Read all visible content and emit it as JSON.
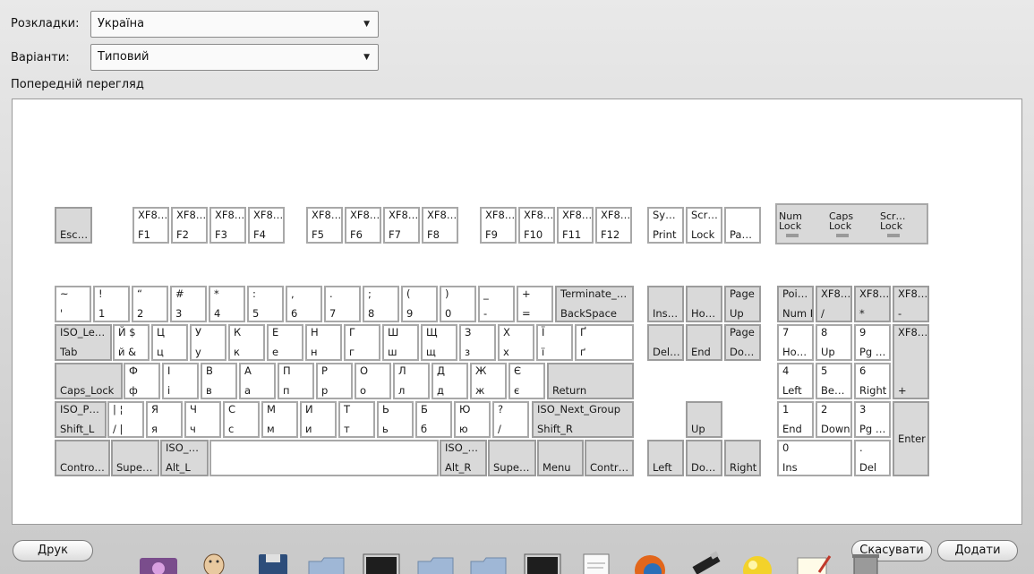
{
  "form": {
    "layouts_label": "Розкладки:",
    "layouts_value": "Україна",
    "variants_label": "Варіанти:",
    "variants_value": "Типовий",
    "preview_label": "Попередній перегляд"
  },
  "buttons": {
    "print": "Друк",
    "cancel": "Скасувати",
    "add": "Додати"
  },
  "colors": {
    "key_fill": "#ffffff",
    "mod_key_fill": "#d9d9d9",
    "key_border": "#a8a8a8"
  },
  "indicators": [
    {
      "top": "Num",
      "bottom": "Lock"
    },
    {
      "top": "Caps",
      "bottom": "Lock"
    },
    {
      "top": "Scr…",
      "bottom": "Lock"
    }
  ],
  "keys": [
    {
      "top": "",
      "bottom": "Esc…",
      "mod": true
    },
    {
      "top": "XF8…",
      "bottom": "F1"
    },
    {
      "top": "XF8…",
      "bottom": "F2"
    },
    {
      "top": "XF8…",
      "bottom": "F3"
    },
    {
      "top": "XF8…",
      "bottom": "F4"
    },
    {
      "top": "XF8…",
      "bottom": "F5"
    },
    {
      "top": "XF8…",
      "bottom": "F6"
    },
    {
      "top": "XF8…",
      "bottom": "F7"
    },
    {
      "top": "XF8…",
      "bottom": "F8"
    },
    {
      "top": "XF8…",
      "bottom": "F9"
    },
    {
      "top": "XF8…",
      "bottom": "F10"
    },
    {
      "top": "XF8…",
      "bottom": "F11"
    },
    {
      "top": "XF8…",
      "bottom": "F12"
    },
    {
      "top": "Sy…",
      "bottom": "Print"
    },
    {
      "top": "Scr…",
      "bottom": "Lock"
    },
    {
      "top": "",
      "bottom": "Pa…"
    },
    {
      "top": "~",
      "bottom": "'"
    },
    {
      "top": "!",
      "bottom": "1"
    },
    {
      "top": "“",
      "bottom": "2"
    },
    {
      "top": "#",
      "bottom": "3"
    },
    {
      "top": "*",
      "bottom": "4"
    },
    {
      "top": ":",
      "bottom": "5"
    },
    {
      "top": ",",
      "bottom": "6"
    },
    {
      "top": ".",
      "bottom": "7"
    },
    {
      "top": ";",
      "bottom": "8"
    },
    {
      "top": "(",
      "bottom": "9"
    },
    {
      "top": ")",
      "bottom": "0"
    },
    {
      "top": "_",
      "bottom": "-"
    },
    {
      "top": "+",
      "bottom": "="
    },
    {
      "top": "Terminate_…",
      "bottom": "BackSpace",
      "mod": true
    },
    {
      "top": "ISO_Le…",
      "bottom": "Tab",
      "mod": true
    },
    {
      "top": "Й $",
      "bottom": "й &"
    },
    {
      "top": "Ц",
      "bottom": "ц"
    },
    {
      "top": "У",
      "bottom": "у"
    },
    {
      "top": "К",
      "bottom": "к"
    },
    {
      "top": "Е",
      "bottom": "е"
    },
    {
      "top": "Н",
      "bottom": "н"
    },
    {
      "top": "Г",
      "bottom": "г"
    },
    {
      "top": "Ш",
      "bottom": "ш"
    },
    {
      "top": "Щ",
      "bottom": "щ"
    },
    {
      "top": "З",
      "bottom": "з"
    },
    {
      "top": "Х",
      "bottom": "х"
    },
    {
      "top": "Ї",
      "bottom": "ї"
    },
    {
      "top": "Ґ",
      "bottom": "ґ"
    },
    {
      "top": "",
      "bottom": "Caps_Lock",
      "mod": true
    },
    {
      "top": "Ф",
      "bottom": "ф"
    },
    {
      "top": "І",
      "bottom": "і"
    },
    {
      "top": "В",
      "bottom": "в"
    },
    {
      "top": "А",
      "bottom": "а"
    },
    {
      "top": "П",
      "bottom": "п"
    },
    {
      "top": "Р",
      "bottom": "р"
    },
    {
      "top": "О",
      "bottom": "о"
    },
    {
      "top": "Л",
      "bottom": "л"
    },
    {
      "top": "Д",
      "bottom": "д"
    },
    {
      "top": "Ж",
      "bottom": "ж"
    },
    {
      "top": "Є",
      "bottom": "є"
    },
    {
      "top": "",
      "bottom": "Return",
      "mod": true
    },
    {
      "top": "ISO_P…",
      "bottom": "Shift_L",
      "mod": true
    },
    {
      "top": "|  ¦",
      "bottom": "/  |"
    },
    {
      "top": "Я",
      "bottom": "я"
    },
    {
      "top": "Ч",
      "bottom": "ч"
    },
    {
      "top": "С",
      "bottom": "с"
    },
    {
      "top": "М",
      "bottom": "м"
    },
    {
      "top": "И",
      "bottom": "и"
    },
    {
      "top": "Т",
      "bottom": "т"
    },
    {
      "top": "Ь",
      "bottom": "ь"
    },
    {
      "top": "Б",
      "bottom": "б"
    },
    {
      "top": "Ю",
      "bottom": "ю"
    },
    {
      "top": "?",
      "bottom": "/"
    },
    {
      "top": "ISO_Next_Group",
      "bottom": "Shift_R",
      "mod": true
    },
    {
      "top": "",
      "bottom": "Contro…",
      "mod": true
    },
    {
      "top": "",
      "bottom": "Supe…",
      "mod": true
    },
    {
      "top": "ISO_…",
      "bottom": "Alt_L",
      "mod": true
    },
    {
      "top": "",
      "bottom": ""
    },
    {
      "top": "ISO_…",
      "bottom": "Alt_R",
      "mod": true
    },
    {
      "top": "",
      "bottom": "Supe…",
      "mod": true
    },
    {
      "top": "",
      "bottom": "Menu",
      "mod": true
    },
    {
      "top": "",
      "bottom": "Contr…",
      "mod": true
    },
    {
      "top": "",
      "bottom": "Ins…",
      "mod": true
    },
    {
      "top": "",
      "bottom": "Ho…",
      "mod": true
    },
    {
      "top": "Page",
      "bottom": "Up",
      "mod": true
    },
    {
      "top": "",
      "bottom": "Del…",
      "mod": true
    },
    {
      "top": "",
      "bottom": "End",
      "mod": true
    },
    {
      "top": "Page",
      "bottom": "Do…",
      "mod": true
    },
    {
      "top": "",
      "bottom": "Up",
      "mod": true
    },
    {
      "top": "",
      "bottom": "Left",
      "mod": true
    },
    {
      "top": "",
      "bottom": "Do…",
      "mod": true
    },
    {
      "top": "",
      "bottom": "Right",
      "mod": true
    },
    {
      "top": "Poi…",
      "bottom": "Num Lock",
      "mod": true
    },
    {
      "top": "XF8…",
      "bottom": "/",
      "mod": true
    },
    {
      "top": "XF8…",
      "bottom": "*",
      "mod": true
    },
    {
      "top": "XF8…",
      "bottom": "-",
      "mod": true
    },
    {
      "top": "7",
      "bottom": "Ho…"
    },
    {
      "top": "8",
      "bottom": "Up"
    },
    {
      "top": "9",
      "bottom": "Pg …"
    },
    {
      "top": "XF8…",
      "bottom": "+",
      "mod": true
    },
    {
      "top": "4",
      "bottom": "Left"
    },
    {
      "top": "5",
      "bottom": "Be…"
    },
    {
      "top": "6",
      "bottom": "Right"
    },
    {
      "top": "1",
      "bottom": "End"
    },
    {
      "top": "2",
      "bottom": "Down"
    },
    {
      "top": "3",
      "bottom": "Pg …"
    },
    {
      "top": "",
      "bottom": "Enter",
      "mod": true
    },
    {
      "top": "0",
      "bottom": "Ins"
    },
    {
      "top": ".",
      "bottom": "Del"
    }
  ]
}
